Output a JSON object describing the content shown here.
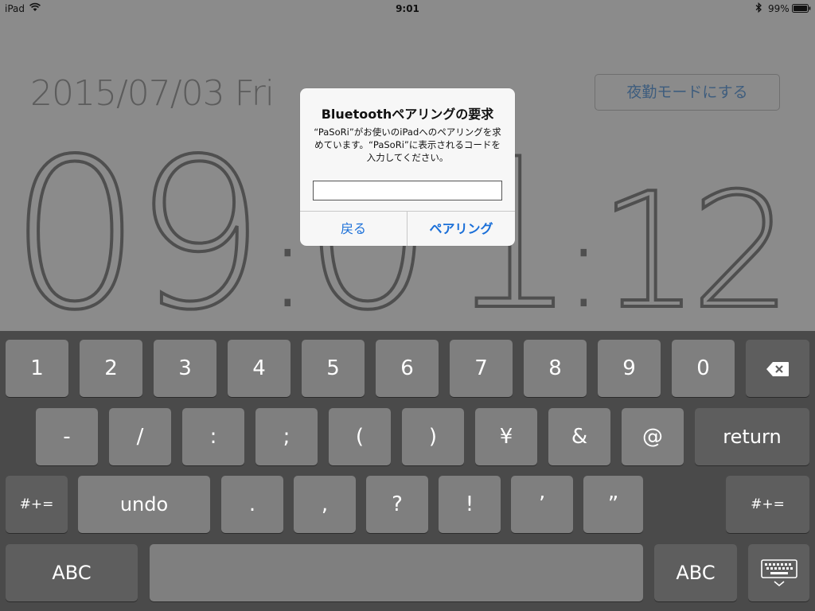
{
  "status_bar": {
    "device": "iPad",
    "time": "9:01",
    "battery": "99%"
  },
  "background": {
    "date": "2015/07/03 Fri",
    "night_mode_button": "夜勤モードにする",
    "clock_digits": [
      "0",
      "9",
      ":",
      "0",
      "1",
      ":",
      "1",
      "2"
    ]
  },
  "dialog": {
    "title": "Bluetoothペアリングの要求",
    "message": "“PaSoRi”がお使いのiPadへのペアリングを求めています。“PaSoRi”に表示されるコードを入力してください。",
    "input_value": "",
    "back_label": "戻る",
    "pair_label": "ペアリング"
  },
  "keyboard": {
    "row1": [
      "1",
      "2",
      "3",
      "4",
      "5",
      "6",
      "7",
      "8",
      "9",
      "0"
    ],
    "row2": [
      "-",
      "/",
      ":",
      ";",
      "(",
      ")",
      "¥",
      "&",
      "@"
    ],
    "return_label": "return",
    "row3_left": "#+=",
    "undo_label": "undo",
    "row3": [
      ".",
      ",",
      "?",
      "!",
      "’",
      "”"
    ],
    "row3_right": "#+=",
    "abc_left": "ABC",
    "abc_right": "ABC"
  },
  "icons": {
    "wifi": "wifi-icon",
    "bluetooth": "bluetooth-icon",
    "battery": "battery-icon",
    "delete": "delete-icon",
    "hide_keyboard": "hide-keyboard-icon"
  }
}
